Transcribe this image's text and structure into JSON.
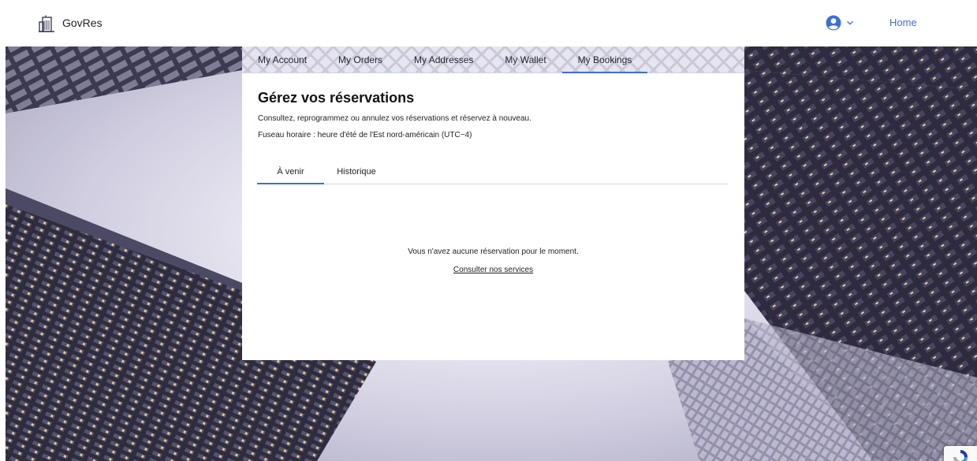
{
  "header": {
    "brand": "GovRes",
    "home_link": "Home",
    "icons": {
      "logo": "building-icon",
      "avatar": "user-circle-icon",
      "chevron": "chevron-down-icon"
    }
  },
  "account_tabs": [
    {
      "label": "My Account",
      "active": false
    },
    {
      "label": "My Orders",
      "active": false
    },
    {
      "label": "My Addresses",
      "active": false
    },
    {
      "label": "My Wallet",
      "active": false
    },
    {
      "label": "My Bookings",
      "active": true
    }
  ],
  "bookings": {
    "title": "Gérez vos réservations",
    "subtitle": "Consultez, reprogrammez ou annulez vos réservations et réservez à nouveau.",
    "timezone": "Fuseau horaire : heure d'été de l'Est nord-américain (UTC−4)",
    "tabs": [
      {
        "label": "À venir",
        "active": true
      },
      {
        "label": "Historique",
        "active": false
      }
    ],
    "empty_message": "Vous n'avez aucune réservation pour le moment.",
    "services_link": "Consulter nos services"
  },
  "colors": {
    "accent": "#3d6fd3",
    "link": "#3a6fd8",
    "text": "#222222"
  }
}
